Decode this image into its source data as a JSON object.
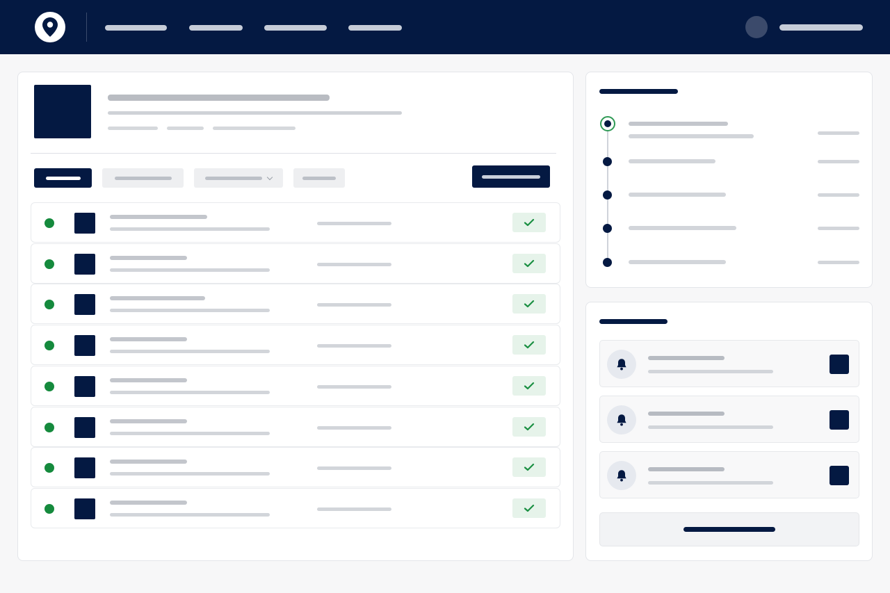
{
  "app": {
    "brand_icon": "map-pin-icon",
    "colors": {
      "navy": "#041942",
      "success": "#158a3d",
      "success_bg": "#e6f3ea",
      "page_bg": "#f7f7f8"
    }
  },
  "header": {
    "nav_links": 4,
    "user": {
      "avatar": "avatar"
    }
  },
  "detail": {
    "tabs": [
      {
        "state": "active"
      },
      {
        "state": "inactive"
      },
      {
        "state": "inactive",
        "dropdown": true,
        "icon": "chevron-down-icon"
      },
      {
        "state": "inactive"
      }
    ],
    "rows": [
      {
        "status": "success",
        "status_icon": "check-icon"
      },
      {
        "status": "success",
        "status_icon": "check-icon"
      },
      {
        "status": "success",
        "status_icon": "check-icon"
      },
      {
        "status": "success",
        "status_icon": "check-icon"
      },
      {
        "status": "success",
        "status_icon": "check-icon"
      },
      {
        "status": "success",
        "status_icon": "check-icon"
      },
      {
        "status": "success",
        "status_icon": "check-icon"
      },
      {
        "status": "success",
        "status_icon": "check-icon"
      }
    ]
  },
  "timeline": {
    "steps": [
      {
        "state": "current"
      },
      {
        "state": "pending"
      },
      {
        "state": "pending"
      },
      {
        "state": "pending"
      },
      {
        "state": "pending"
      }
    ]
  },
  "alerts": {
    "items": [
      {
        "icon": "bell-icon"
      },
      {
        "icon": "bell-icon"
      },
      {
        "icon": "bell-icon"
      }
    ]
  }
}
